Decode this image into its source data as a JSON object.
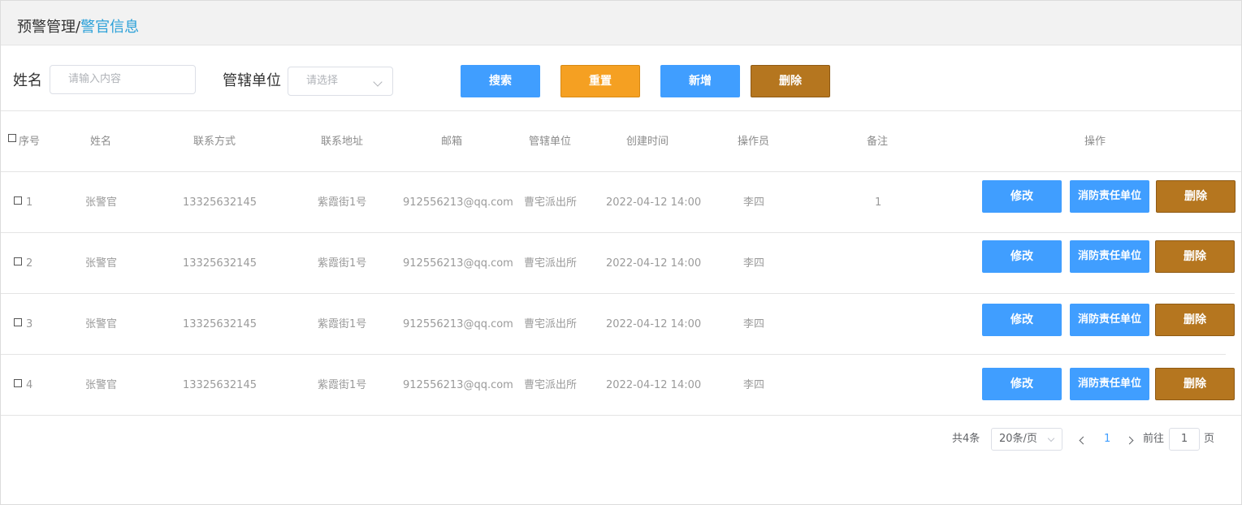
{
  "breadcrumb": {
    "root": "预警管理",
    "separator": "/",
    "current": "警官信息"
  },
  "filters": {
    "name_label": "姓名",
    "name_placeholder": "请输入内容",
    "unit_label": "管辖单位",
    "unit_placeholder": "请选择"
  },
  "toolbar": {
    "search": "搜索",
    "reset": "重置",
    "add": "新增",
    "delete": "删除"
  },
  "table": {
    "columns": [
      "序号",
      "姓名",
      "联系方式",
      "联系地址",
      "邮箱",
      "管辖单位",
      "创建时间",
      "操作员",
      "备注",
      "操作"
    ],
    "rows": [
      {
        "index": "1",
        "name": "张警官",
        "phone": "13325632145",
        "address": "紫霞街1号",
        "email": "912556213@qq.com",
        "unit": "曹宅派出所",
        "created": "2022-04-12 14:00",
        "operator": "李四",
        "remark": "1"
      },
      {
        "index": "2",
        "name": "张警官",
        "phone": "13325632145",
        "address": "紫霞街1号",
        "email": "912556213@qq.com",
        "unit": "曹宅派出所",
        "created": "2022-04-12 14:00",
        "operator": "李四",
        "remark": ""
      },
      {
        "index": "3",
        "name": "张警官",
        "phone": "13325632145",
        "address": "紫霞街1号",
        "email": "912556213@qq.com",
        "unit": "曹宅派出所",
        "created": "2022-04-12 14:00",
        "operator": "李四",
        "remark": ""
      },
      {
        "index": "4",
        "name": "张警官",
        "phone": "13325632145",
        "address": "紫霞街1号",
        "email": "912556213@qq.com",
        "unit": "曹宅派出所",
        "created": "2022-04-12 14:00",
        "operator": "李四",
        "remark": ""
      }
    ],
    "row_actions": {
      "edit": "修改",
      "fire_unit": "消防责任单位",
      "delete": "删除"
    }
  },
  "pagination": {
    "total": "共4条",
    "page_size": "20条/页",
    "current_page": "1",
    "goto_prefix": "前往",
    "goto_value": "1",
    "goto_suffix": "页"
  },
  "colors": {
    "primary": "#409eff",
    "warning": "#f5a022",
    "danger_brown": "#b5761f",
    "link": "#2aa0d8"
  }
}
